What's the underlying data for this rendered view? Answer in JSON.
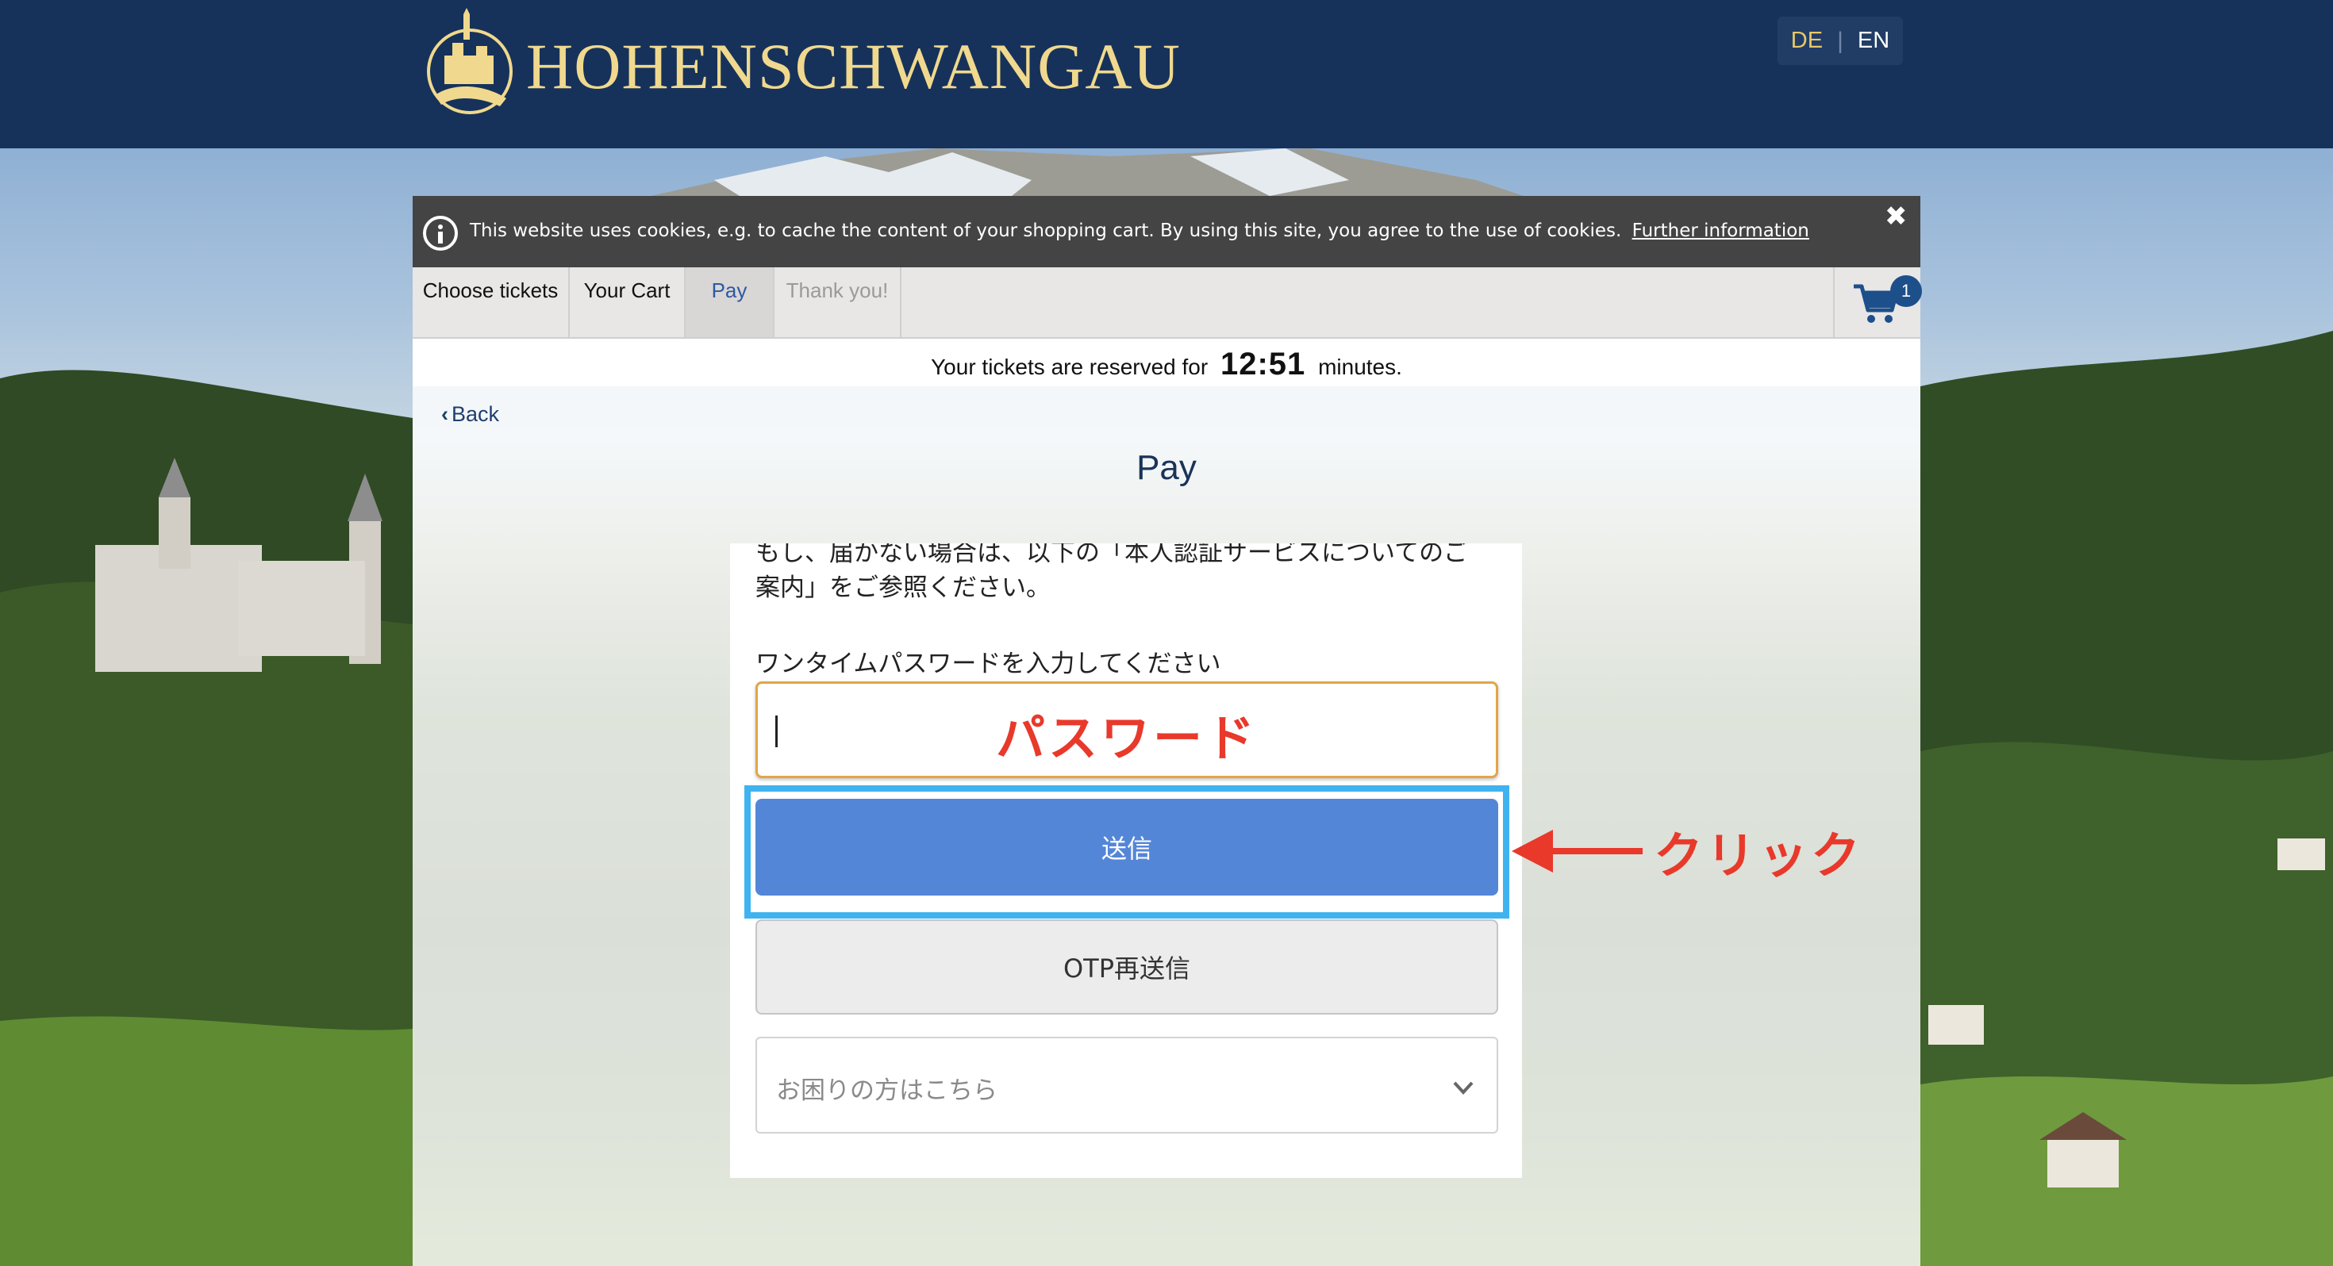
{
  "header": {
    "brand": "HOHENSCHWANGAU",
    "lang_de": "DE",
    "lang_sep": "|",
    "lang_en": "EN"
  },
  "cookie_banner": {
    "message": "This website uses cookies, e.g. to cache the content of your shopping cart. By using this site, you agree to the use of cookies.",
    "link": "Further information",
    "close": "✖"
  },
  "steps": [
    {
      "label": "Choose tickets",
      "state": "done"
    },
    {
      "label": "Your Cart",
      "state": "done"
    },
    {
      "label": "Pay",
      "state": "active"
    },
    {
      "label": "Thank you!",
      "state": "disabled"
    }
  ],
  "cart": {
    "count": "1"
  },
  "timer": {
    "prefix": "Your tickets are reserved for",
    "time": "12:51",
    "suffix": "minutes."
  },
  "nav": {
    "back": "Back"
  },
  "page_title": "Pay",
  "otp": {
    "text_line1": "もし、届かない場合は、以下の「本人認証サービスについてのご",
    "text_line2": "案内」をご参照ください。",
    "input_label": "ワンタイムパスワードを入力してください",
    "input_value": "",
    "submit": "送信",
    "resend": "OTP再送信",
    "help": "お困りの方はこちら"
  },
  "annotations": {
    "password": "パスワード",
    "click": "クリック",
    "color": "#e8392b",
    "highlight_color": "#3fb3ef"
  },
  "colors": {
    "header_bg": "#17325a",
    "brand_gold": "#f0d98e",
    "submit_bg": "#5486d8"
  }
}
